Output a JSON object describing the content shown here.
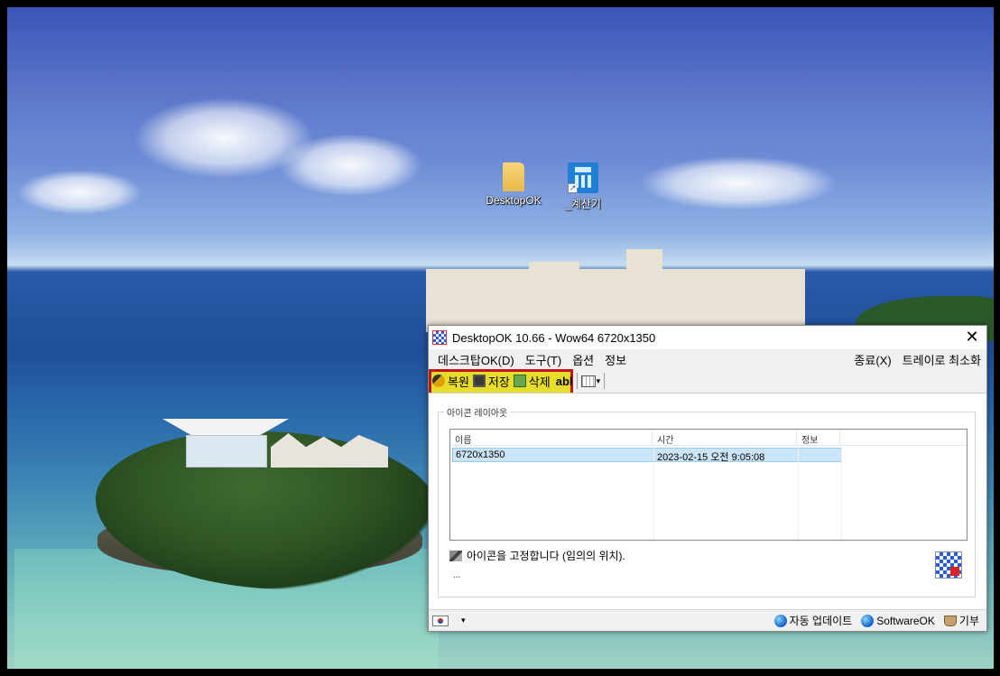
{
  "desktop": {
    "icons": [
      {
        "label": "DesktopOK",
        "icon": "folder-icon"
      },
      {
        "label": "_계산기",
        "icon": "calculator-icon"
      }
    ]
  },
  "window": {
    "title": "DesktopOK 10.66 - Wow64 6720x1350",
    "close_glyph": "✕",
    "menu": {
      "left": [
        "데스크탑OK(D)",
        "도구(T)",
        "옵션",
        "정보"
      ],
      "right": [
        "종료(X)",
        "트레이로 최소화"
      ]
    },
    "toolbar": {
      "restore_label": "복원",
      "save_label": "저장",
      "delete_label": "삭제",
      "abl_label": "abl",
      "caret": "▾",
      "highlight_color": "#c0161b"
    },
    "group_label": "아이콘 레이아웃",
    "list": {
      "columns": [
        "이름",
        "시간",
        "정보"
      ],
      "rows": [
        {
          "name": "6720x1350",
          "time": "2023-02-15 오전 9:05:08",
          "info": ""
        }
      ]
    },
    "lock_text": "아이콘을 고정합니다 (임의의 위치).",
    "dots": "...",
    "status": {
      "caret": "▾",
      "auto_update": "자동 업데이트",
      "softwareok": "SoftwareOK",
      "donate": "기부"
    }
  }
}
